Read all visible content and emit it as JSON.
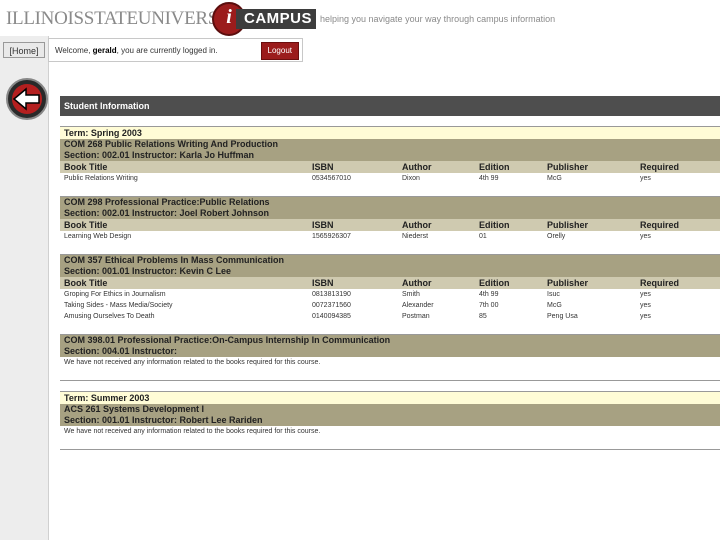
{
  "header": {
    "university": "ILLINOISSTATEUNIVERSITY",
    "logo_letter": "i",
    "logo_word": "CAMPUS",
    "tagline": "helping you navigate your way through campus information"
  },
  "nav": {
    "home_label": "Home"
  },
  "welcome": {
    "prefix": "Welcome, ",
    "user": "gerald",
    "suffix": ", you are currently logged in.",
    "logout_label": "Logout"
  },
  "page": {
    "title": "Student Information",
    "columns": [
      "Book Title",
      "ISBN",
      "Author",
      "Edition",
      "Publisher",
      "Required"
    ]
  },
  "terms": [
    {
      "term": "Term: Spring 2003",
      "courses": [
        {
          "line1": "COM 268   Public Relations Writing And Production",
          "line2": "Section: 002.01   Instructor: Karla Jo Huffman",
          "books": [
            {
              "title": "Public Relations Writing",
              "isbn": "0534567010",
              "author": "Dixon",
              "edition": "4th 99",
              "publisher": "McG",
              "required": "yes"
            }
          ]
        },
        {
          "line1": "COM 298   Professional Practice:Public Relations",
          "line2": "Section: 002.01   Instructor: Joel Robert Johnson",
          "books": [
            {
              "title": "Learning Web Design",
              "isbn": "1565926307",
              "author": "Niederst",
              "edition": "01",
              "publisher": "Orelly",
              "required": "yes"
            }
          ]
        },
        {
          "line1": "COM 357   Ethical Problems In Mass Communication",
          "line2": "Section: 001.01   Instructor: Kevin C Lee",
          "books": [
            {
              "title": "Groping For Ethics in Journalism",
              "isbn": "0813813190",
              "author": "Smith",
              "edition": "4th 99",
              "publisher": "Isuc",
              "required": "yes"
            },
            {
              "title": "Taking Sides - Mass Media/Society",
              "isbn": "0072371560",
              "author": "Alexander",
              "edition": "7th 00",
              "publisher": "McG",
              "required": "yes"
            },
            {
              "title": "Amusing Ourselves To Death",
              "isbn": "0140094385",
              "author": "Postman",
              "edition": "85",
              "publisher": "Peng Usa",
              "required": "yes"
            }
          ]
        },
        {
          "line1": "COM 398.01   Professional Practice:On-Campus Internship In Communication",
          "line2": "Section: 004.01   Instructor:",
          "note": "We have not received any information related to the books required for this course."
        }
      ]
    },
    {
      "term": "Term: Summer 2003",
      "courses": [
        {
          "line1": "ACS 261   Systems Development I",
          "line2": "Section: 001.01   Instructor: Robert Lee Rariden",
          "note": "We have not received any information related to the books required for this course."
        }
      ]
    }
  ],
  "colors": {
    "section_bar": "#4e4e4e",
    "course_head": "#a7a182",
    "column_head": "#cfcab0",
    "term_bg": "#fffcd6",
    "accent_red": "#9b1c1c"
  }
}
